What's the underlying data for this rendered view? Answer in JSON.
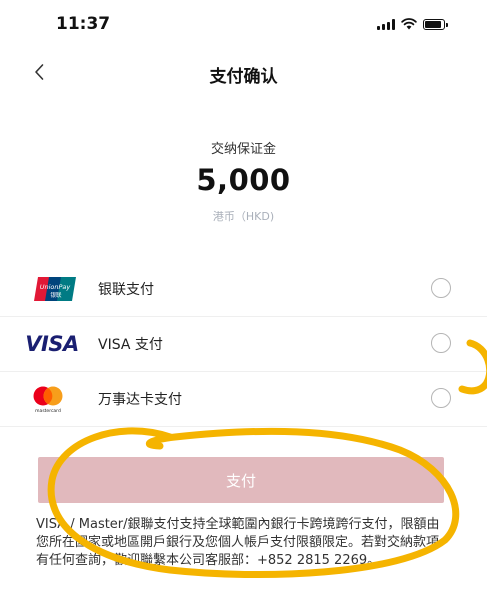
{
  "status_bar": {
    "time": "11:37",
    "icons": [
      "signal-icon",
      "wifi-icon",
      "battery-icon"
    ]
  },
  "nav": {
    "back_icon": "chevron-left-icon",
    "title": "支付确认"
  },
  "amount": {
    "label": "交纳保证金",
    "value": "5,000",
    "currency": "港币（HKD)"
  },
  "payment_methods": [
    {
      "logo": "unionpay-logo",
      "logo_text": "UnionPay 银联",
      "label": "银联支付",
      "selected": false
    },
    {
      "logo": "visa-logo",
      "logo_text": "VISA",
      "label": "VISA 支付",
      "selected": false
    },
    {
      "logo": "mastercard-logo",
      "logo_text": "mastercard",
      "label": "万事达卡支付",
      "selected": false
    }
  ],
  "pay_button": {
    "label": "支付",
    "disabled_color": "#e1b9bd"
  },
  "notice": "VISA / Master/銀聯支付支持全球範圍內銀行卡跨境跨行支付，限額由您所在國家或地區開戶銀行及您個人帳戶支付限額限定。若對交納款項有任何查詢，歡迎聯繫本公司客服部：+852 2815 2269。",
  "colors": {
    "annotation": "#f5b400",
    "visa_blue": "#1a1f71",
    "currency_grey": "#aab0ba"
  }
}
